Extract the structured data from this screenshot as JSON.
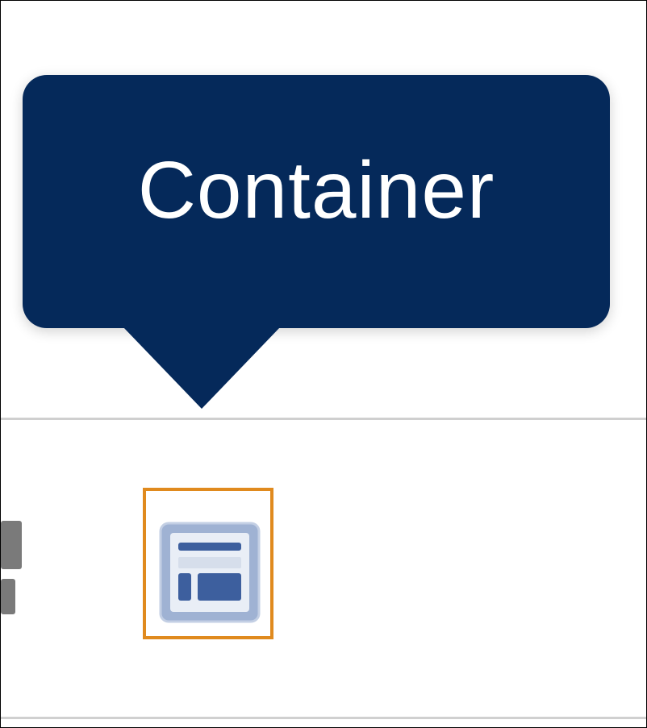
{
  "tooltip": {
    "label": "Container"
  },
  "toolbar": {
    "items": [
      {
        "icon": "container-icon"
      }
    ]
  },
  "colors": {
    "tooltip_bg": "#05295a",
    "tooltip_text": "#ffffff",
    "highlight_border": "#e08a1e",
    "icon_fill": "#9fb2d3",
    "icon_accent": "#3d5f9e"
  }
}
